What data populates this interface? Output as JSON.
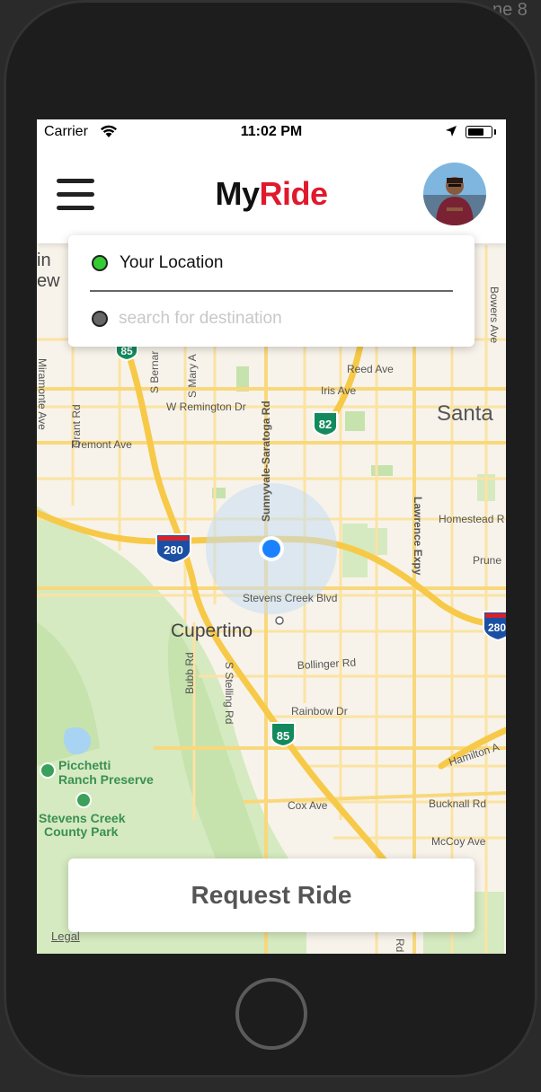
{
  "background": {
    "fragment": "ne 8"
  },
  "status_bar": {
    "carrier": "Carrier",
    "time": "11:02 PM",
    "battery_level": 0.75
  },
  "header": {
    "brand_part1": "My",
    "brand_part2": "Ride",
    "brand_color": "#e0192c"
  },
  "location_card": {
    "origin_label": "Your Location",
    "destination_placeholder": "search for destination",
    "origin_dot_color": "#33cc33"
  },
  "map": {
    "labels": {
      "in": "in",
      "ew": "ew",
      "reed_ave": "Reed Ave",
      "iris_ave": "Iris Ave",
      "santa": "Santa",
      "bowers_ave": "Bowers Ave",
      "w_remington": "W Remington Dr",
      "grant_rd": "Grant Rd",
      "miramonte": "Miramonte Ave",
      "fremont": "Fremont Ave",
      "s_bernardo": "S Bernar",
      "s_mary": "S Mary A",
      "sunnyvale": "Sunnyvale-Saratoga Rd",
      "lawrence": "Lawrence Expy",
      "homestead": "Homestead R",
      "prune": "Prune",
      "stevens_creek": "Stevens Creek Blvd",
      "cupertino": "Cupertino",
      "bubb": "Bubb Rd",
      "stelling": "S Stelling Rd",
      "bollinger": "Bollinger Rd",
      "rainbow": "Rainbow Dr",
      "hamilton": "Hamilton A",
      "picchetti_1": "Picchetti",
      "picchetti_2": "Ranch Preserve",
      "stevens_park_1": "Stevens Creek",
      "stevens_park_2": "County Park",
      "cox": "Cox Ave",
      "bucknall": "Bucknall Rd",
      "mccoy": "McCoy Ave",
      "bottom_rd": "Rd"
    },
    "shields": {
      "hwy85": "85",
      "hwy280": "280",
      "hwy82": "82"
    },
    "colors": {
      "land": "#f7f3ea",
      "park": "#cfe8b8",
      "freeway": "#f7c948",
      "street": "#fbe3a3",
      "water": "#a9d3f2",
      "current_location": "#1a82ff"
    }
  },
  "actions": {
    "request_ride": "Request Ride"
  },
  "footer": {
    "legal": "Legal"
  }
}
